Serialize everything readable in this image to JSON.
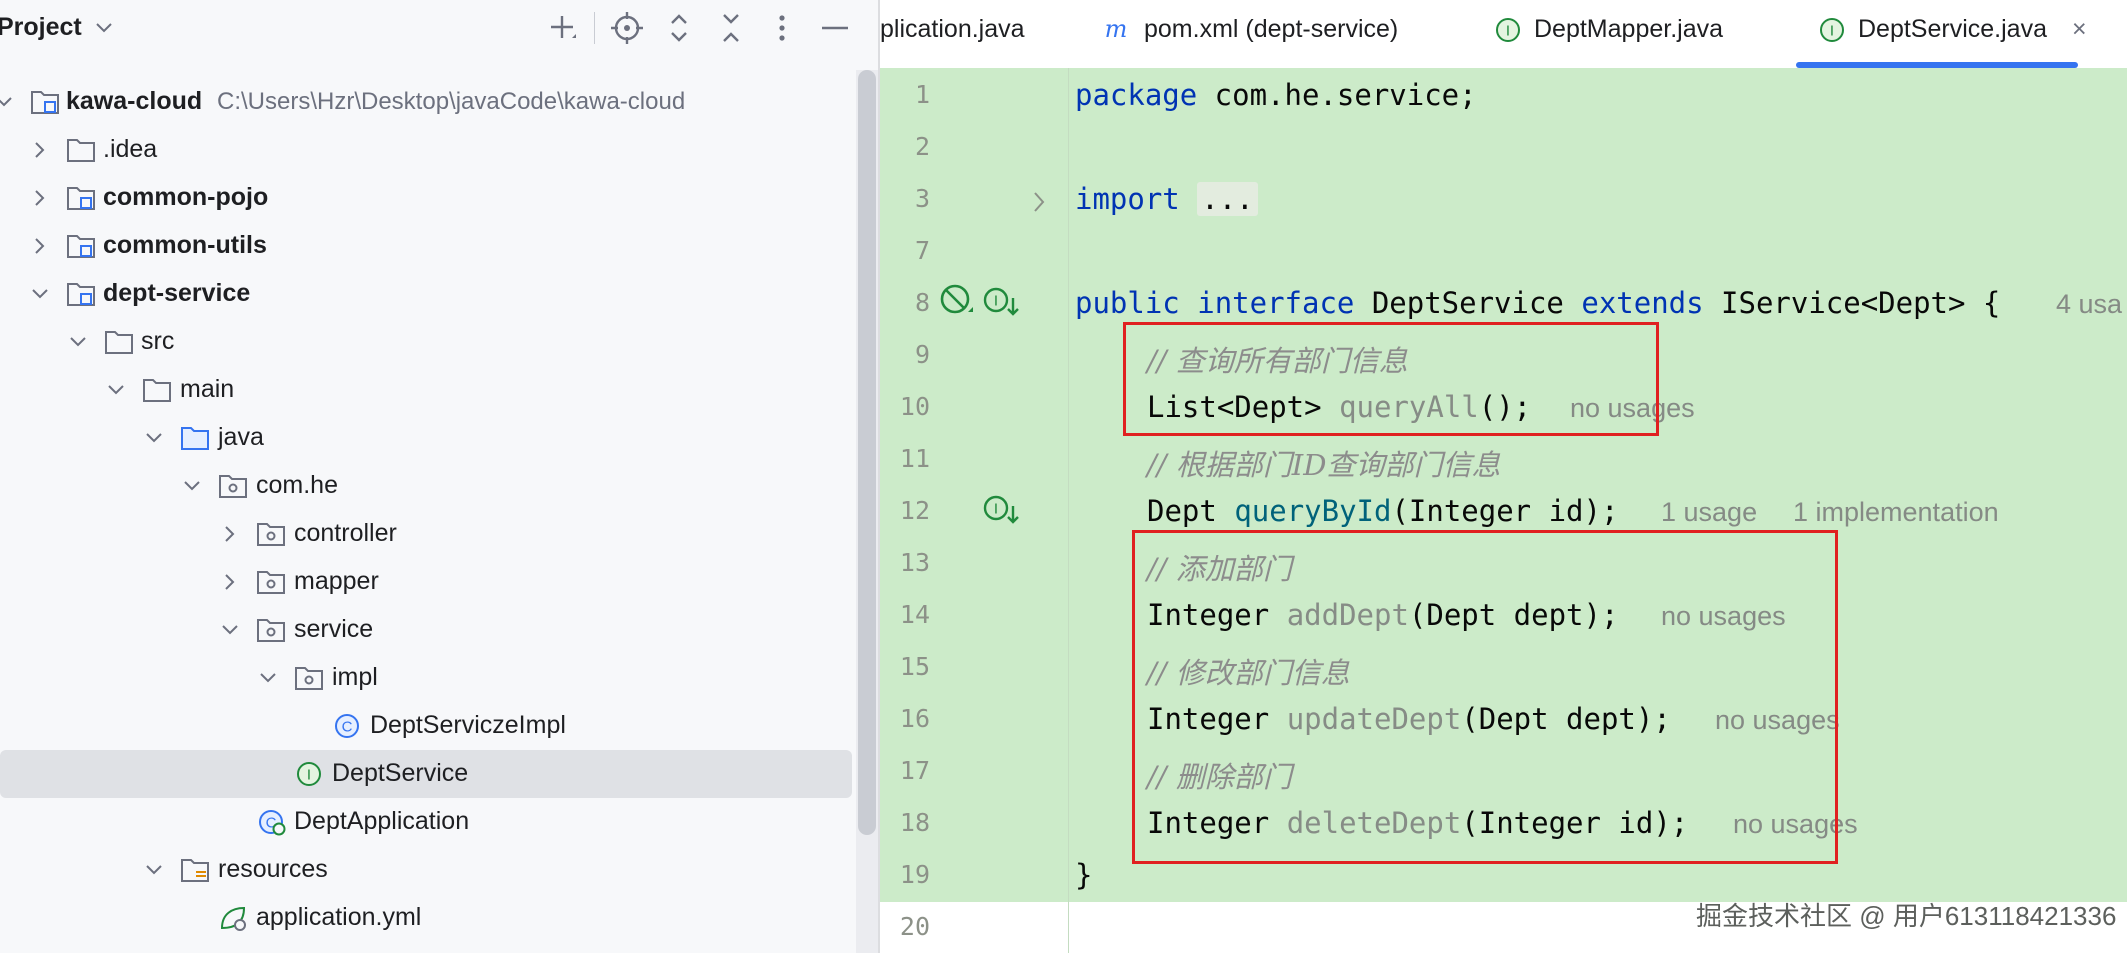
{
  "project_panel": {
    "title": "Project",
    "toolbar_icons": [
      "add-icon",
      "locate-icon",
      "expand-all-icon",
      "collapse-all-icon",
      "more-icon",
      "hide-icon"
    ],
    "tree": [
      {
        "label": "kawa-cloud",
        "path": "C:\\Users\\Hzr\\Desktop\\javaCode\\kawa-cloud",
        "bold": true,
        "icon": "module-folder-icon"
      },
      {
        "label": ".idea",
        "bold": false,
        "icon": "folder-icon"
      },
      {
        "label": "common-pojo",
        "bold": true,
        "icon": "module-folder-icon"
      },
      {
        "label": "common-utils",
        "bold": true,
        "icon": "module-folder-icon"
      },
      {
        "label": "dept-service",
        "bold": true,
        "icon": "module-folder-icon"
      },
      {
        "label": "src",
        "bold": false,
        "icon": "folder-icon"
      },
      {
        "label": "main",
        "bold": false,
        "icon": "folder-icon"
      },
      {
        "label": "java",
        "bold": false,
        "icon": "source-folder-icon"
      },
      {
        "label": "com.he",
        "bold": false,
        "icon": "package-icon"
      },
      {
        "label": "controller",
        "bold": false,
        "icon": "package-icon"
      },
      {
        "label": "mapper",
        "bold": false,
        "icon": "package-icon"
      },
      {
        "label": "service",
        "bold": false,
        "icon": "package-icon"
      },
      {
        "label": "impl",
        "bold": false,
        "icon": "package-icon"
      },
      {
        "label": "DeptServiczeImpl",
        "bold": false,
        "icon": "class-icon"
      },
      {
        "label": "DeptService",
        "bold": false,
        "icon": "interface-icon",
        "selected": true
      },
      {
        "label": "DeptApplication",
        "bold": false,
        "icon": "spring-boot-class-icon"
      },
      {
        "label": "resources",
        "bold": false,
        "icon": "resources-folder-icon"
      },
      {
        "label": "application.yml",
        "bold": false,
        "icon": "spring-config-icon"
      }
    ]
  },
  "tabs": [
    {
      "label": "plication.java",
      "icon": "",
      "active": false
    },
    {
      "label": "pom.xml (dept-service)",
      "icon": "maven-icon",
      "active": false
    },
    {
      "label": "DeptMapper.java",
      "icon": "interface-icon",
      "active": false
    },
    {
      "label": "DeptService.java",
      "icon": "interface-icon",
      "active": true,
      "close": "×"
    }
  ],
  "editor": {
    "line_numbers": [
      "1",
      "2",
      "3",
      "7",
      "8",
      "9",
      "10",
      "11",
      "12",
      "13",
      "14",
      "15",
      "16",
      "17",
      "18",
      "19",
      "20"
    ],
    "code": {
      "l1": {
        "kw": "package",
        "rest": " com.he.service;"
      },
      "l3": {
        "kw": "import",
        "fold": "..."
      },
      "l8": {
        "kw1": "public",
        "kw2": "interface",
        "name": " DeptService ",
        "kw3": "extends",
        "rest": " IService<Dept> {",
        "hint": "4 usa"
      },
      "l9": "// 查询所有部门信息",
      "l10": {
        "type": "List<Dept> ",
        "method": "queryAll",
        "rest": "();",
        "hint": "no usages"
      },
      "l11": "// 根据部门ID查询部门信息",
      "l12": {
        "type": "Dept ",
        "method": "queryById",
        "rest": "(Integer id);",
        "hint1": "1 usage",
        "hint2": "1 implementation"
      },
      "l13": "// 添加部门",
      "l14": {
        "type": "Integer ",
        "method": "addDept",
        "rest": "(Dept dept);",
        "hint": "no usages"
      },
      "l15": "// 修改部门信息",
      "l16": {
        "type": "Integer ",
        "method": "updateDept",
        "rest": "(Dept dept);",
        "hint": "no usages"
      },
      "l17": "// 删除部门",
      "l18": {
        "type": "Integer ",
        "method": "deleteDept",
        "rest": "(Integer id);",
        "hint": "no usages"
      },
      "l19": "}"
    }
  },
  "watermark": "掘金技术社区 @ 用户613118421336",
  "colors": {
    "diff_green": "#ccebc9",
    "keyword": "#0033b3",
    "highlight_box": "#e02020",
    "accent": "#3574f0"
  }
}
